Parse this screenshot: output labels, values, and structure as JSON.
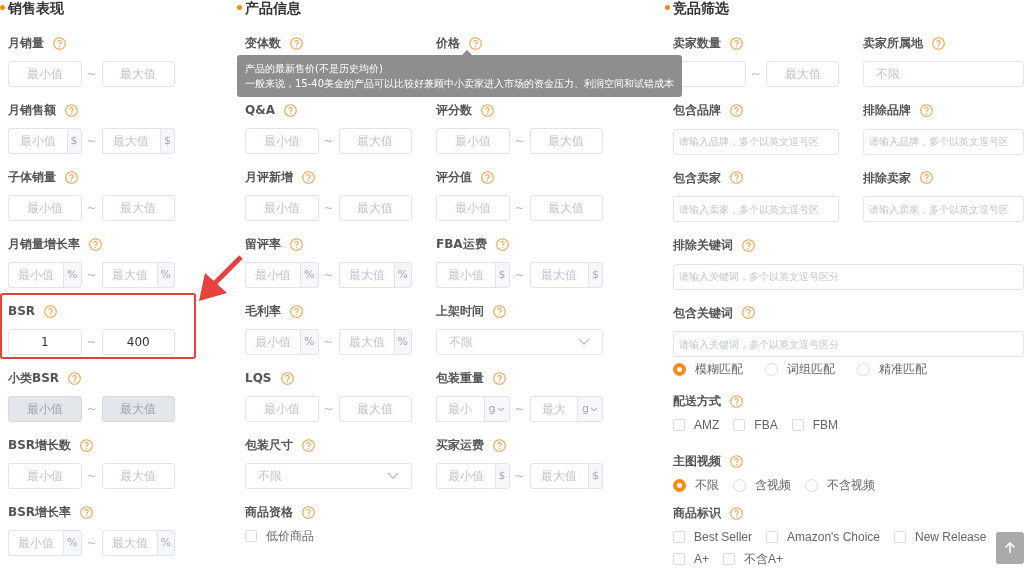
{
  "sections": [
    {
      "title": "销售表现",
      "fields": [
        {
          "kind": "range",
          "label": "月销量",
          "min": {
            "placeholder": "最小值"
          },
          "max": {
            "placeholder": "最大值"
          },
          "sep": "~",
          "disabled": false,
          "highlighted": false
        },
        {
          "kind": "range",
          "label": "月销售额",
          "min": {
            "placeholder": "最小值",
            "unit": "$"
          },
          "max": {
            "placeholder": "最大值",
            "unit": "$"
          },
          "sep": "~",
          "disabled": false,
          "highlighted": false
        },
        {
          "kind": "range",
          "label": "子体销量",
          "min": {
            "placeholder": "最小值"
          },
          "max": {
            "placeholder": "最大值"
          },
          "sep": "~",
          "disabled": false,
          "highlighted": false
        },
        {
          "kind": "range",
          "label": "月销量增长率",
          "min": {
            "placeholder": "最小值",
            "unit": "%"
          },
          "max": {
            "placeholder": "最大值",
            "unit": "%"
          },
          "sep": "~",
          "disabled": false,
          "highlighted": false
        },
        {
          "kind": "range",
          "label": "BSR",
          "min": {
            "value": "1"
          },
          "max": {
            "value": "400"
          },
          "sep": "~",
          "disabled": false,
          "highlighted": true
        },
        {
          "kind": "range",
          "label": "小类BSR",
          "min": {
            "placeholder": "最小值"
          },
          "max": {
            "placeholder": "最大值"
          },
          "sep": "~",
          "disabled": true,
          "highlighted": false
        },
        {
          "kind": "range",
          "label": "BSR增长数",
          "min": {
            "placeholder": "最小值"
          },
          "max": {
            "placeholder": "最大值"
          },
          "sep": "~",
          "disabled": false,
          "highlighted": false
        },
        {
          "kind": "range",
          "label": "BSR增长率",
          "min": {
            "placeholder": "最小值",
            "unit": "%"
          },
          "max": {
            "placeholder": "最大值",
            "unit": "%"
          },
          "sep": "~",
          "disabled": false,
          "highlighted": false
        }
      ]
    },
    {
      "title": "产品信息",
      "fields": [
        {
          "kind": "range",
          "label": "变体数",
          "highlighted": false
        },
        {
          "kind": "range",
          "label": "价格",
          "highlighted": false
        },
        {
          "kind": "range",
          "label": "Q&A",
          "min": {
            "placeholder": "最小值"
          },
          "max": {
            "placeholder": "最大值"
          },
          "sep": "~",
          "disabled": false,
          "highlighted": false
        },
        {
          "kind": "range",
          "label": "评分数",
          "min": {
            "placeholder": "最小值"
          },
          "max": {
            "placeholder": "最大值"
          },
          "sep": "~",
          "disabled": false,
          "highlighted": false
        },
        {
          "kind": "range",
          "label": "月评新增",
          "min": {
            "placeholder": "最小值"
          },
          "max": {
            "placeholder": "最大值"
          },
          "sep": "~",
          "disabled": false,
          "highlighted": false
        },
        {
          "kind": "range",
          "label": "评分值",
          "min": {
            "placeholder": "最小值"
          },
          "max": {
            "placeholder": "最大值"
          },
          "sep": "~",
          "disabled": false,
          "highlighted": false
        },
        {
          "kind": "range",
          "label": "留评率",
          "min": {
            "placeholder": "最小值",
            "unit": "%"
          },
          "max": {
            "placeholder": "最大值",
            "unit": "%"
          },
          "sep": "~",
          "disabled": false,
          "highlighted": false
        },
        {
          "kind": "range",
          "label": "FBA运费",
          "min": {
            "placeholder": "最小值",
            "unit": "$"
          },
          "max": {
            "placeholder": "最大值",
            "unit": "$"
          },
          "sep": "~",
          "disabled": false,
          "highlighted": false
        },
        {
          "kind": "range",
          "label": "毛利率",
          "min": {
            "placeholder": "最小值",
            "unit": "%"
          },
          "max": {
            "placeholder": "最大值",
            "unit": "%"
          },
          "sep": "~",
          "disabled": false,
          "highlighted": false
        },
        {
          "kind": "select",
          "label": "上架时间",
          "placeholder": "不限"
        },
        {
          "kind": "range",
          "label": "LQS",
          "min": {
            "placeholder": "最小值"
          },
          "max": {
            "placeholder": "最大值"
          },
          "sep": "~",
          "disabled": false,
          "highlighted": false
        },
        {
          "kind": "range",
          "label": "包装重量",
          "min": {
            "placeholder": "最小",
            "unit": "g"
          },
          "max": {
            "placeholder": "最大",
            "unit": "g"
          },
          "unit_dropdown": true,
          "sep": "~",
          "disabled": false,
          "highlighted": false
        },
        {
          "kind": "select",
          "label": "包装尺寸",
          "placeholder": "不限"
        },
        {
          "kind": "range",
          "label": "买家运费",
          "min": {
            "placeholder": "最小值",
            "unit": "$"
          },
          "max": {
            "placeholder": "最大值",
            "unit": "$"
          },
          "sep": "~",
          "disabled": false,
          "highlighted": false
        },
        {
          "kind": "checks",
          "label": "商品资格",
          "options": [
            {
              "label": "低价商品",
              "checked": false
            }
          ]
        }
      ]
    },
    {
      "title": "竞品筛选",
      "fields": [
        {
          "kind": "range",
          "label": "卖家数量",
          "max": {
            "placeholder": "最大值"
          },
          "sep": "~",
          "disabled": false,
          "highlighted": false
        },
        {
          "kind": "select",
          "label": "卖家所属地",
          "placeholder": "不限",
          "open_end": true
        },
        {
          "kind": "text",
          "label": "包含品牌",
          "placeholder": "请输入品牌，多个以英文逗号区"
        },
        {
          "kind": "text",
          "label": "排除品牌",
          "placeholder": "请输入品牌，多个以英文逗号区"
        },
        {
          "kind": "text",
          "label": "包含卖家",
          "placeholder": "请输入卖家，多个以英文逗号区"
        },
        {
          "kind": "text",
          "label": "排除卖家",
          "placeholder": "请输入卖家，多个以英文逗号区"
        },
        {
          "kind": "text",
          "label": "排除关键词",
          "placeholder": "请输入关键词，多个以英文逗号区分",
          "wide": true
        },
        {
          "kind": "text",
          "label": "包含关键词",
          "placeholder": "请输入关键词，多个以英文逗号区分",
          "wide": true,
          "match": [
            {
              "label": "模糊匹配",
              "selected": true
            },
            {
              "label": "词组匹配",
              "selected": false
            },
            {
              "label": "精准匹配",
              "selected": false
            }
          ]
        },
        {
          "kind": "checks",
          "label": "配送方式",
          "wide": true,
          "options": [
            {
              "label": "AMZ",
              "checked": false
            },
            {
              "label": "FBA",
              "checked": false
            },
            {
              "label": "FBM",
              "checked": false
            }
          ]
        },
        {
          "kind": "radios",
          "label": "主图视频",
          "wide": true,
          "options": [
            {
              "label": "不限",
              "selected": true
            },
            {
              "label": "含视频",
              "selected": false
            },
            {
              "label": "不含视频",
              "selected": false
            }
          ]
        },
        {
          "kind": "checks",
          "label": "商品标识",
          "wide": true,
          "options": [
            {
              "label": "Best Seller",
              "checked": false
            },
            {
              "label": "Amazon's Choice",
              "checked": false
            },
            {
              "label": "New Release",
              "checked": false
            },
            {
              "label": "A+",
              "checked": false
            },
            {
              "label": "不含A+",
              "checked": false
            }
          ]
        }
      ]
    }
  ],
  "tooltip": {
    "lines": [
      "产品的最新售价(不是历史均价)",
      "一般来说，15-40美金的产品可以比较好兼顾中小卖家进入市场的资金压力、利润空间和试错成本"
    ]
  }
}
